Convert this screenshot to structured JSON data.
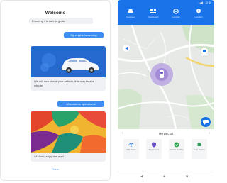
{
  "chat": {
    "title": "Welcome",
    "bot_msg_1": "Ensuring it is safe to go to.",
    "user_msg_1": "My engine is running",
    "card_1_text": "We will now check your vehicle, this may take a minute.",
    "user_msg_2": "All systems operational",
    "card_2_text": "All done, enjoy the app!",
    "done_label": "Done"
  },
  "dashboard": {
    "status_time": "12:30",
    "nav_items": [
      {
        "label": "Overview",
        "icon": "car-icon"
      },
      {
        "label": "Dashboard",
        "icon": "dashboard-icon"
      },
      {
        "label": "Controls",
        "icon": "controls-icon"
      },
      {
        "label": "Location",
        "icon": "location-icon"
      }
    ],
    "date": "Mo Dec 30",
    "tiles": [
      {
        "label": "Wifi Status",
        "icon": "wifi-icon",
        "color": "#3d8ef0"
      },
      {
        "label": "My Account",
        "icon": "shield-icon",
        "color": "#6a4fc2"
      },
      {
        "label": "Vehicle Healthy",
        "icon": "check-icon",
        "color": "#35a853"
      },
      {
        "label": "Fuel Station",
        "icon": "fuel-icon",
        "color": "#2e9e5b"
      }
    ]
  },
  "colors": {
    "accent": "#1a73e8",
    "bubble": "#3d8ef0",
    "vehicle_marker": "#b8a4e0"
  }
}
